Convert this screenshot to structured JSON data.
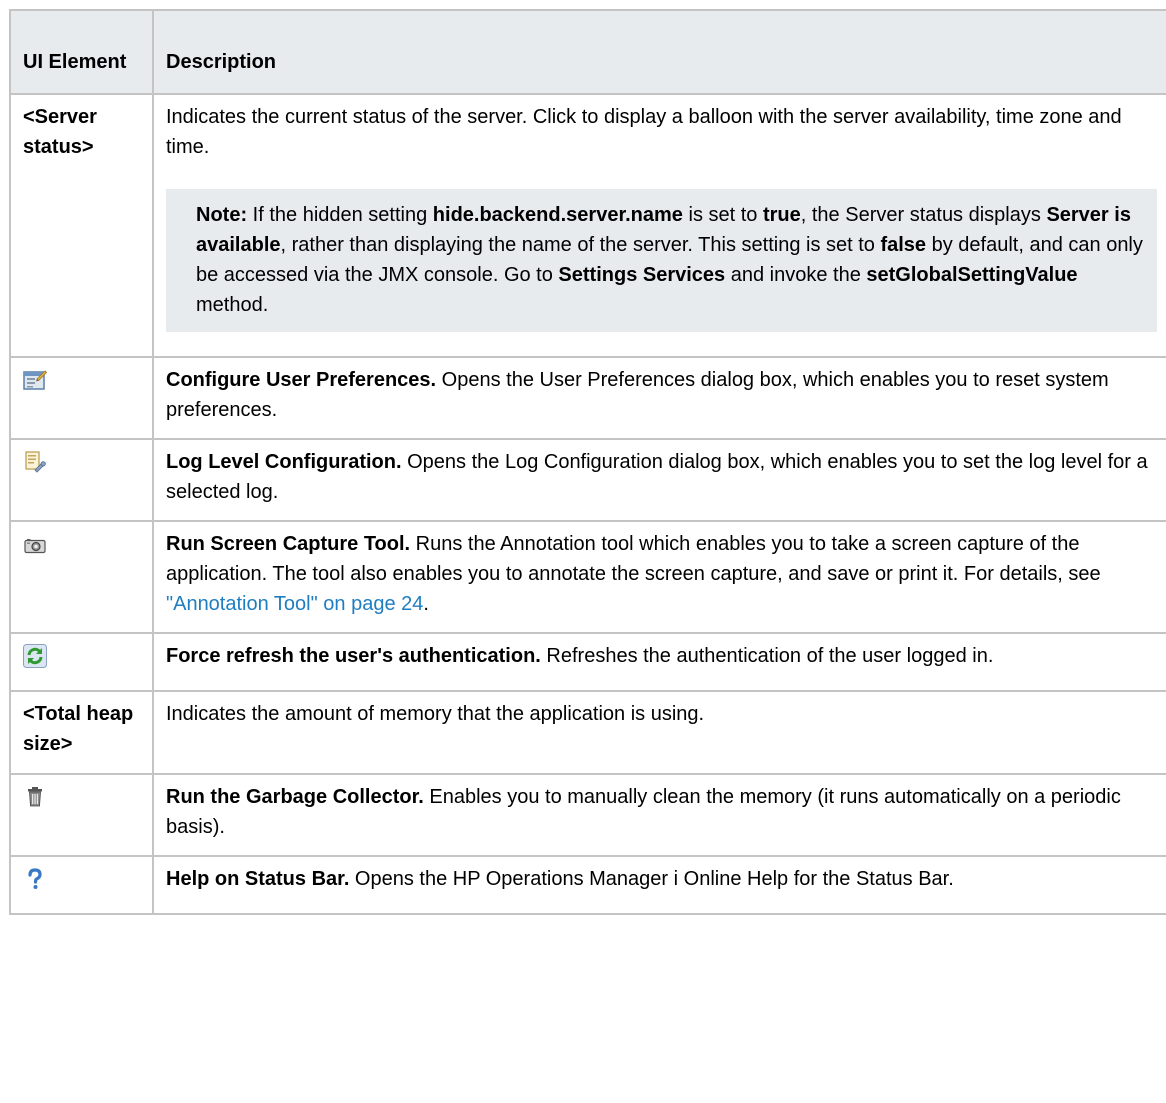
{
  "header": {
    "col1": "UI Element",
    "col2": "Description"
  },
  "rows": [
    {
      "element": "<Server status>",
      "desc": "Indicates the current status of the server. Click to display a balloon with the server availability, time zone and time.",
      "note": {
        "label": "Note:",
        "t1": " If the hidden setting ",
        "b1": "hide.backend.server.name",
        "t2": " is set to ",
        "b2": "true",
        "t3": ", the Server status displays ",
        "b3": "Server is available",
        "t4": ", rather than displaying the name of the server. This setting is set to ",
        "b4": "false",
        "t5": " by default, and can only be accessed via the JMX console. Go to ",
        "b5": "Settings Services",
        "t6": " and invoke the ",
        "b6": "setGlobalSettingValue",
        "t7": " method."
      }
    },
    {
      "icon": "user-preferences-icon",
      "title": "Configure User Preferences.",
      "desc": " Opens the User Preferences dialog box, which enables you to reset system preferences."
    },
    {
      "icon": "log-level-config-icon",
      "title": "Log Level Configuration.",
      "desc": " Opens the Log Configuration dialog box, which enables you to set the log level for a selected log."
    },
    {
      "icon": "camera-icon",
      "title": "Run Screen Capture Tool.",
      "desc": " Runs the Annotation tool which enables you to take a screen capture of the application. The tool also enables you to annotate the screen capture, and save or print it. For details, see ",
      "link": "\"Annotation Tool\" on page 24",
      "after": "."
    },
    {
      "icon": "refresh-icon",
      "title": "Force refresh the user's authentication.",
      "desc": " Refreshes the authentication of the user logged in."
    },
    {
      "element": "<Total heap size>",
      "desc": "Indicates the amount of memory that the application is using."
    },
    {
      "icon": "trash-icon",
      "title": "Run the Garbage Collector.",
      "desc": " Enables you to manually clean the memory (it runs automatically on a periodic basis)."
    },
    {
      "icon": "help-icon",
      "title": "Help on Status Bar.",
      "desc": " Opens the HP Operations Manager i Online Help for the Status Bar."
    }
  ]
}
